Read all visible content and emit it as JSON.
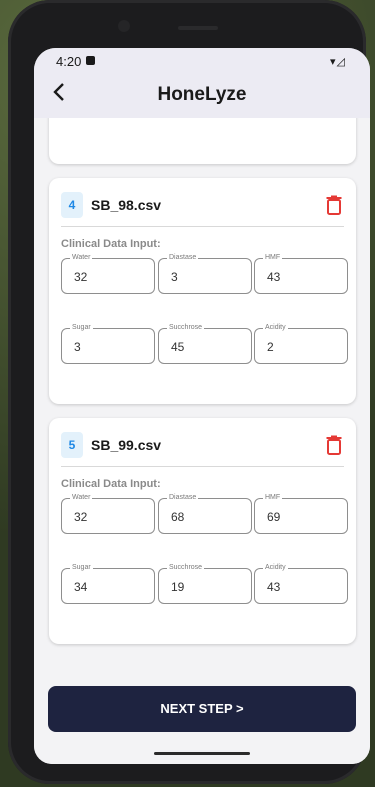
{
  "status": {
    "time": "4:20",
    "signal": "▾◿"
  },
  "app": {
    "title": "HoneLyze",
    "back_icon": "chevron-left-icon"
  },
  "cards": [
    {
      "index": "4",
      "filename": "SB_98.csv",
      "section_label": "Clinical Data Input:",
      "fields": [
        {
          "label": "Water",
          "value": "32"
        },
        {
          "label": "Diastase",
          "value": "3"
        },
        {
          "label": "HMF",
          "value": "43"
        },
        {
          "label": "Sugar",
          "value": "3"
        },
        {
          "label": "Succhrose",
          "value": "45"
        },
        {
          "label": "Acidity",
          "value": "2"
        }
      ]
    },
    {
      "index": "5",
      "filename": "SB_99.csv",
      "section_label": "Clinical Data Input:",
      "fields": [
        {
          "label": "Water",
          "value": "32"
        },
        {
          "label": "Diastase",
          "value": "68"
        },
        {
          "label": "HMF",
          "value": "69"
        },
        {
          "label": "Sugar",
          "value": "34"
        },
        {
          "label": "Succhrose",
          "value": "19"
        },
        {
          "label": "Acidity",
          "value": "43"
        }
      ]
    }
  ],
  "next_button": {
    "label": "NEXT STEP >"
  },
  "colors": {
    "accent": "#1e88e5",
    "delete": "#e53935",
    "button": "#1e2340"
  }
}
